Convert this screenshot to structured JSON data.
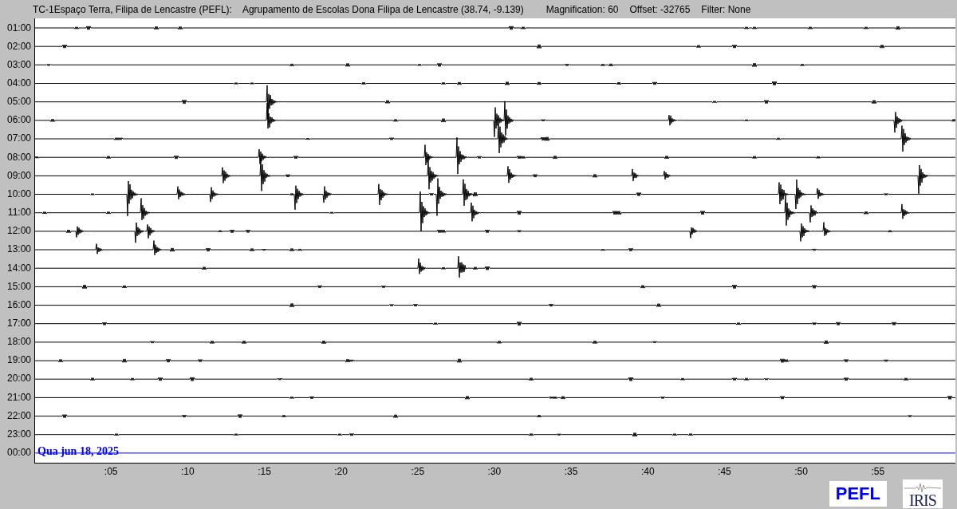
{
  "header": {
    "station": "TC-1Espaço Terra, Filipa de Lencastre (PEFL):",
    "location": "Agrupamento de Escolas Dona Filipa de Lencastre (38.74, -9.139)",
    "magnification": "Magnification: 60",
    "offset": "Offset: -32765",
    "filter": "Filter: None"
  },
  "hours": [
    "01:00",
    "02:00",
    "03:00",
    "04:00",
    "05:00",
    "06:00",
    "07:00",
    "08:00",
    "09:00",
    "10:00",
    "11:00",
    "12:00",
    "13:00",
    "14:00",
    "15:00",
    "16:00",
    "17:00",
    "18:00",
    "19:00",
    "20:00",
    "21:00",
    "22:00",
    "23:00",
    "00:00"
  ],
  "date": "Qua jun 18, 2025",
  "minutes": [
    ":05",
    ":10",
    ":15",
    ":20",
    ":25",
    ":30",
    ":35",
    ":40",
    ":45",
    ":50",
    ":55"
  ],
  "logos": {
    "station": "PEFL",
    "network": "IRIS"
  }
}
